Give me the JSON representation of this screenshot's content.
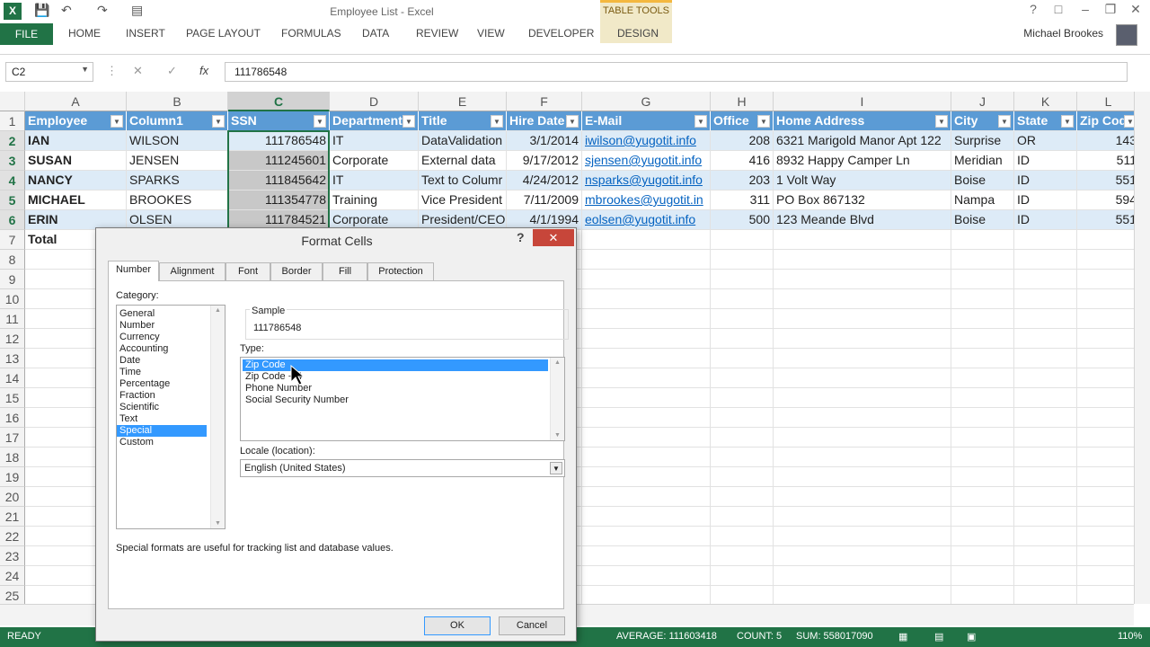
{
  "titlebar": {
    "title": "Employee List - Excel",
    "table_tools": "TABLE TOOLS"
  },
  "ribbon": {
    "file": "FILE",
    "tabs": [
      "HOME",
      "INSERT",
      "PAGE LAYOUT",
      "FORMULAS",
      "DATA",
      "REVIEW",
      "VIEW",
      "DEVELOPER"
    ],
    "design": "DESIGN",
    "user": "Michael Brookes"
  },
  "formula_bar": {
    "name_box": "C2",
    "fx": "fx",
    "value": "111786548"
  },
  "columns": [
    "A",
    "B",
    "C",
    "D",
    "E",
    "F",
    "G",
    "H",
    "I",
    "J",
    "K",
    "L"
  ],
  "rows": [
    "1",
    "2",
    "3",
    "4",
    "5",
    "6",
    "7",
    "8",
    "9",
    "10",
    "11",
    "12",
    "13",
    "14",
    "15",
    "16",
    "17",
    "18",
    "19",
    "20",
    "21",
    "22",
    "23",
    "24",
    "25"
  ],
  "table": {
    "headers": [
      "Employee",
      "Column1",
      "SSN",
      "Department",
      "Title",
      "Hire Date",
      "E-Mail",
      "Office",
      "Home Address",
      "City",
      "State",
      "Zip Code"
    ],
    "data": [
      [
        "IAN",
        "WILSON",
        "111786548",
        "IT",
        "DataValidation",
        "3/1/2014",
        "iwilson@yugotit.info",
        "208",
        "6321 Marigold Manor Apt 122",
        "Surprise",
        "OR",
        "143"
      ],
      [
        "SUSAN",
        "JENSEN",
        "111245601",
        "Corporate",
        "External data",
        "9/17/2012",
        "sjensen@yugotit.info",
        "416",
        "8932 Happy Camper Ln",
        "Meridian",
        "ID",
        "511"
      ],
      [
        "NANCY",
        "SPARKS",
        "111845642",
        "IT",
        "Text to Columr",
        "4/24/2012",
        "nsparks@yugotit.info",
        "203",
        "1 Volt Way",
        "Boise",
        "ID",
        "551"
      ],
      [
        "MICHAEL",
        "BROOKES",
        "111354778",
        "Training",
        "Vice President",
        "7/11/2009",
        "mbrookes@yugotit.in",
        "311",
        "PO Box 867132",
        "Nampa",
        "ID",
        "594"
      ],
      [
        "ERIN",
        "OLSEN",
        "111784521",
        "Corporate",
        "President/CEO",
        "4/1/1994",
        "eolsen@yugotit.info",
        "500",
        "123 Meande Blvd",
        "Boise",
        "ID",
        "551"
      ]
    ],
    "total_label": "Total"
  },
  "dialog": {
    "title": "Format Cells",
    "help": "?",
    "close": "✕",
    "tabs": [
      "Number",
      "Alignment",
      "Font",
      "Border",
      "Fill",
      "Protection"
    ],
    "category_label": "Category:",
    "categories": [
      "General",
      "Number",
      "Currency",
      "Accounting",
      "Date",
      "Time",
      "Percentage",
      "Fraction",
      "Scientific",
      "Text",
      "Special",
      "Custom"
    ],
    "selected_category": "Special",
    "sample_label": "Sample",
    "sample_value": "111786548",
    "type_label": "Type:",
    "types": [
      "Zip Code",
      "Zip Code + 4",
      "Phone Number",
      "Social Security Number"
    ],
    "selected_type": "Zip Code",
    "locale_label": "Locale (location):",
    "locale_value": "English (United States)",
    "description": "Special formats are useful for tracking list and database values.",
    "ok": "OK",
    "cancel": "Cancel"
  },
  "status": {
    "ready": "READY",
    "average": "AVERAGE: 111603418",
    "count": "COUNT: 5",
    "sum": "SUM: 558017090",
    "zoom": "110%"
  },
  "colors": {
    "excel_green": "#217346",
    "table_header": "#5b9bd5",
    "band": "#ddebf7",
    "selection": "#3399ff"
  }
}
